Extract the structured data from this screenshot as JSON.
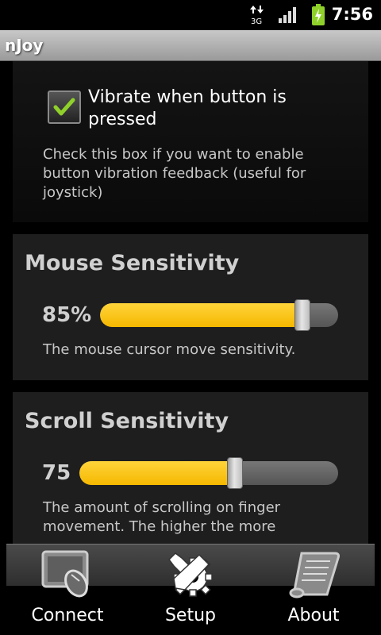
{
  "status_bar": {
    "time": "7:56",
    "network_label": "3G",
    "icons": [
      "data-arrows-icon",
      "signal-icon",
      "battery-charging-icon"
    ]
  },
  "app": {
    "title": "nJoy"
  },
  "vibrate": {
    "label": "Vibrate when button is pressed",
    "checked": true,
    "description": "Check this box if you want to enable button vibration feedback (useful for joystick)"
  },
  "mouse_sensitivity": {
    "title": "Mouse Sensitivity",
    "value_text": "85%",
    "level": 0.85,
    "description": "The mouse cursor move sensitivity."
  },
  "scroll_sensitivity": {
    "title": "Scroll Sensitivity",
    "value_text": "75",
    "level": 0.6,
    "description": "The amount of scrolling on finger movement. The higher the more"
  },
  "tabs": [
    {
      "label": "Connect",
      "icon": "touchpad-mouse-icon"
    },
    {
      "label": "Setup",
      "icon": "tools-gear-icon"
    },
    {
      "label": "About",
      "icon": "scroll-document-icon"
    }
  ],
  "colors": {
    "accent": "#f5b800",
    "check": "#8fd12a"
  }
}
